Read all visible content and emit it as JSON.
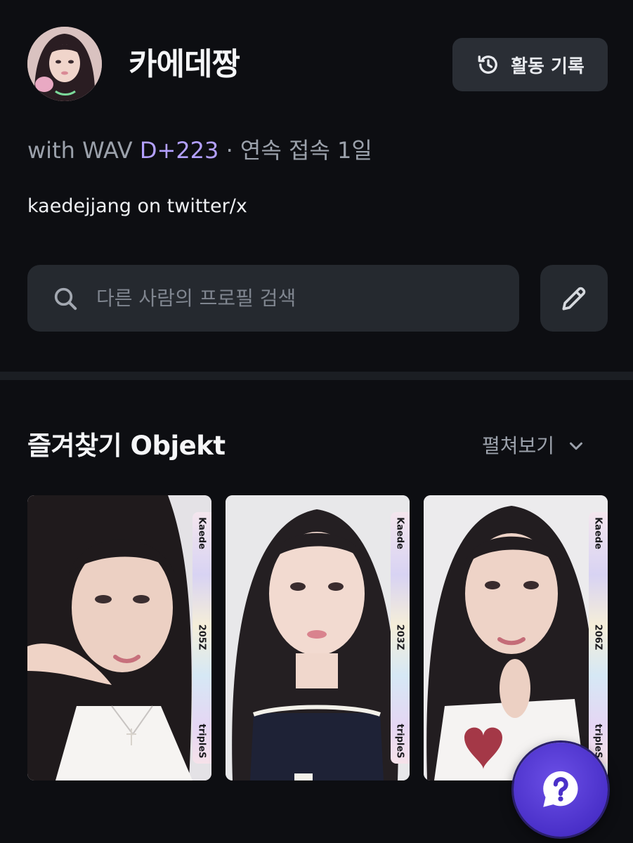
{
  "profile": {
    "username": "카에데짱",
    "stats_prefix": "with WAV",
    "dday": "D+223",
    "stats_suffix": "· 연속 접속 1일",
    "bio": "kaedejjang on twitter/x"
  },
  "header": {
    "history_label": "활동 기록"
  },
  "search": {
    "placeholder": "다른 사람의 프로필 검색",
    "value": ""
  },
  "favorites": {
    "title": "즐겨찾기 Objekt",
    "expand_label": "펼쳐보기",
    "cards": [
      {
        "member": "Kaede",
        "serial": "205Z",
        "group": "tripleS"
      },
      {
        "member": "Kaede",
        "serial": "203Z",
        "group": "tripleS"
      },
      {
        "member": "Kaede",
        "serial": "206Z",
        "group": "tripleS"
      }
    ]
  },
  "icons": {
    "history": "history-clock-icon",
    "search": "search-icon",
    "edit": "pencil-icon",
    "expand": "chevron-down-icon",
    "help": "help-chat-icon"
  },
  "colors": {
    "background": "#0d0e12",
    "surface": "#25292f",
    "accent": "#b3a0ff",
    "help_button": "#4a30c9"
  }
}
